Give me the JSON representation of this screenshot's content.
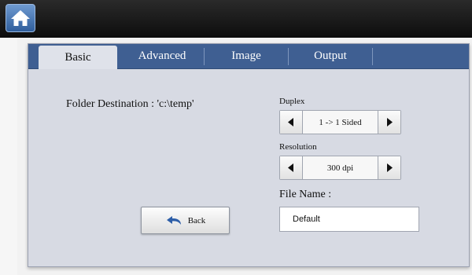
{
  "header": {
    "home_icon": "home-icon"
  },
  "tabs": [
    {
      "label": "Basic",
      "active": true
    },
    {
      "label": "Advanced",
      "active": false
    },
    {
      "label": "Image",
      "active": false
    },
    {
      "label": "Output",
      "active": false
    }
  ],
  "basic": {
    "folder_destination": "Folder Destination : 'c:\\temp'",
    "duplex": {
      "label": "Duplex",
      "value": "1 -> 1 Sided"
    },
    "resolution": {
      "label": "Resolution",
      "value": "300 dpi"
    },
    "file_name": {
      "label": "File Name :",
      "value": "Default"
    },
    "back_label": "Back"
  },
  "colors": {
    "tab_bar": "#3f5f92",
    "panel_bg": "#d7dae3",
    "home_button": "#4a78b8",
    "back_arrow": "#2d5ea8"
  }
}
